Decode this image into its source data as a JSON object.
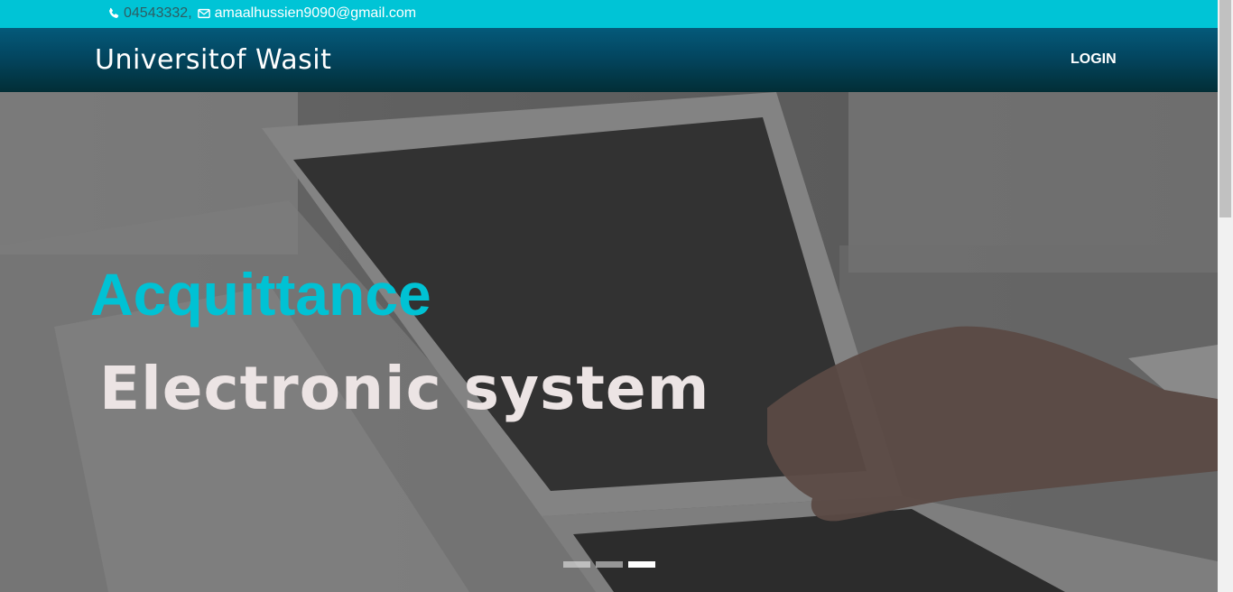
{
  "topbar": {
    "phone": "04543332",
    "separator": ",",
    "email": "amaalhussien9090@gmail.com"
  },
  "navbar": {
    "brand": "Universitof Wasit",
    "login_label": "LOGIN"
  },
  "hero": {
    "headline": "Acquittance",
    "subline": "Electronic system",
    "slide_count": 3,
    "active_slide": 3
  },
  "colors": {
    "accent": "#00c4d6",
    "navbar_top": "#045a7a",
    "navbar_bottom": "#022e36",
    "headline": "#00c2d4"
  }
}
